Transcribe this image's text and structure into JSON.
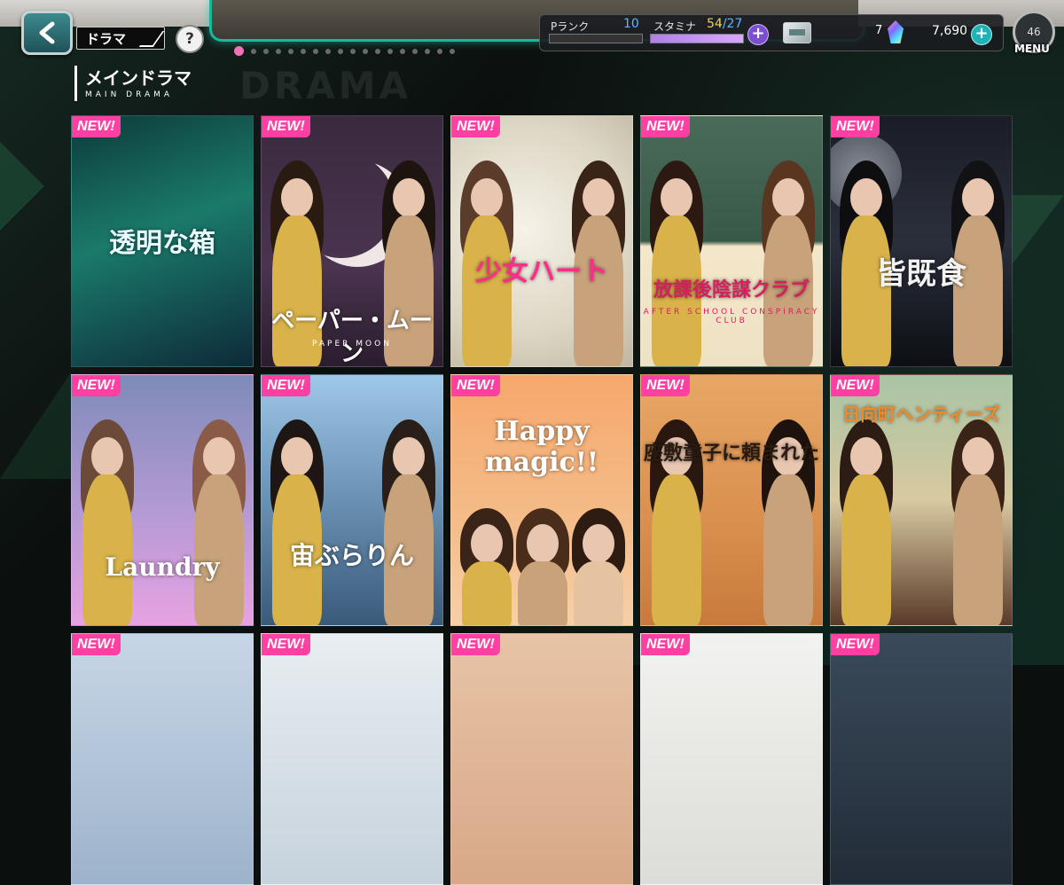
{
  "header": {
    "back_label": "",
    "tab_label": "ドラマ",
    "help_label": "?",
    "page_dots_total": 18,
    "page_dot_active": 1
  },
  "status": {
    "rank_label": "Pランク",
    "rank_value": "10",
    "rank_progress": 0.0,
    "stamina_label": "スタミナ",
    "stamina_current": "54",
    "stamina_sep": "/",
    "stamina_max": "27",
    "stamina_progress": 1.0,
    "plus_symbol": "+",
    "gem_count": "7",
    "coin_count": "7,690",
    "menu_label": "MENU",
    "menu_level": "46"
  },
  "section": {
    "title_ja": "メインドラマ",
    "title_en": "MAIN DRAMA",
    "bg_word": "DRAMA"
  },
  "cards": [
    {
      "badge": "NEW!",
      "title": "透明な箱",
      "subtitle": ""
    },
    {
      "badge": "NEW!",
      "title": "ペーパー・ムーン",
      "subtitle": "PAPER MOON"
    },
    {
      "badge": "NEW!",
      "title": "少女ハート",
      "subtitle": ""
    },
    {
      "badge": "NEW!",
      "title": "放課後陰謀クラブ",
      "subtitle": "AFTER SCHOOL CONSPIRACY CLUB"
    },
    {
      "badge": "NEW!",
      "title": "皆既食",
      "subtitle": ""
    },
    {
      "badge": "NEW!",
      "title": "Laundry",
      "subtitle": ""
    },
    {
      "badge": "NEW!",
      "title": "宙ぶらりん",
      "subtitle": ""
    },
    {
      "badge": "NEW!",
      "title": "Happy magic!!",
      "subtitle": ""
    },
    {
      "badge": "NEW!",
      "title": "座敷童子に頼まれた",
      "subtitle": ""
    },
    {
      "badge": "NEW!",
      "title": "日向町ヘンティーズ",
      "subtitle": ""
    },
    {
      "badge": "NEW!",
      "title": "",
      "subtitle": ""
    },
    {
      "badge": "NEW!",
      "title": "",
      "subtitle": ""
    },
    {
      "badge": "NEW!",
      "title": "",
      "subtitle": ""
    },
    {
      "badge": "NEW!",
      "title": "",
      "subtitle": ""
    },
    {
      "badge": "NEW!",
      "title": "",
      "subtitle": ""
    }
  ],
  "colors": {
    "badge": "#ff3fa2",
    "accent_teal": "#18b89a",
    "dot_active": "#f072b4"
  }
}
